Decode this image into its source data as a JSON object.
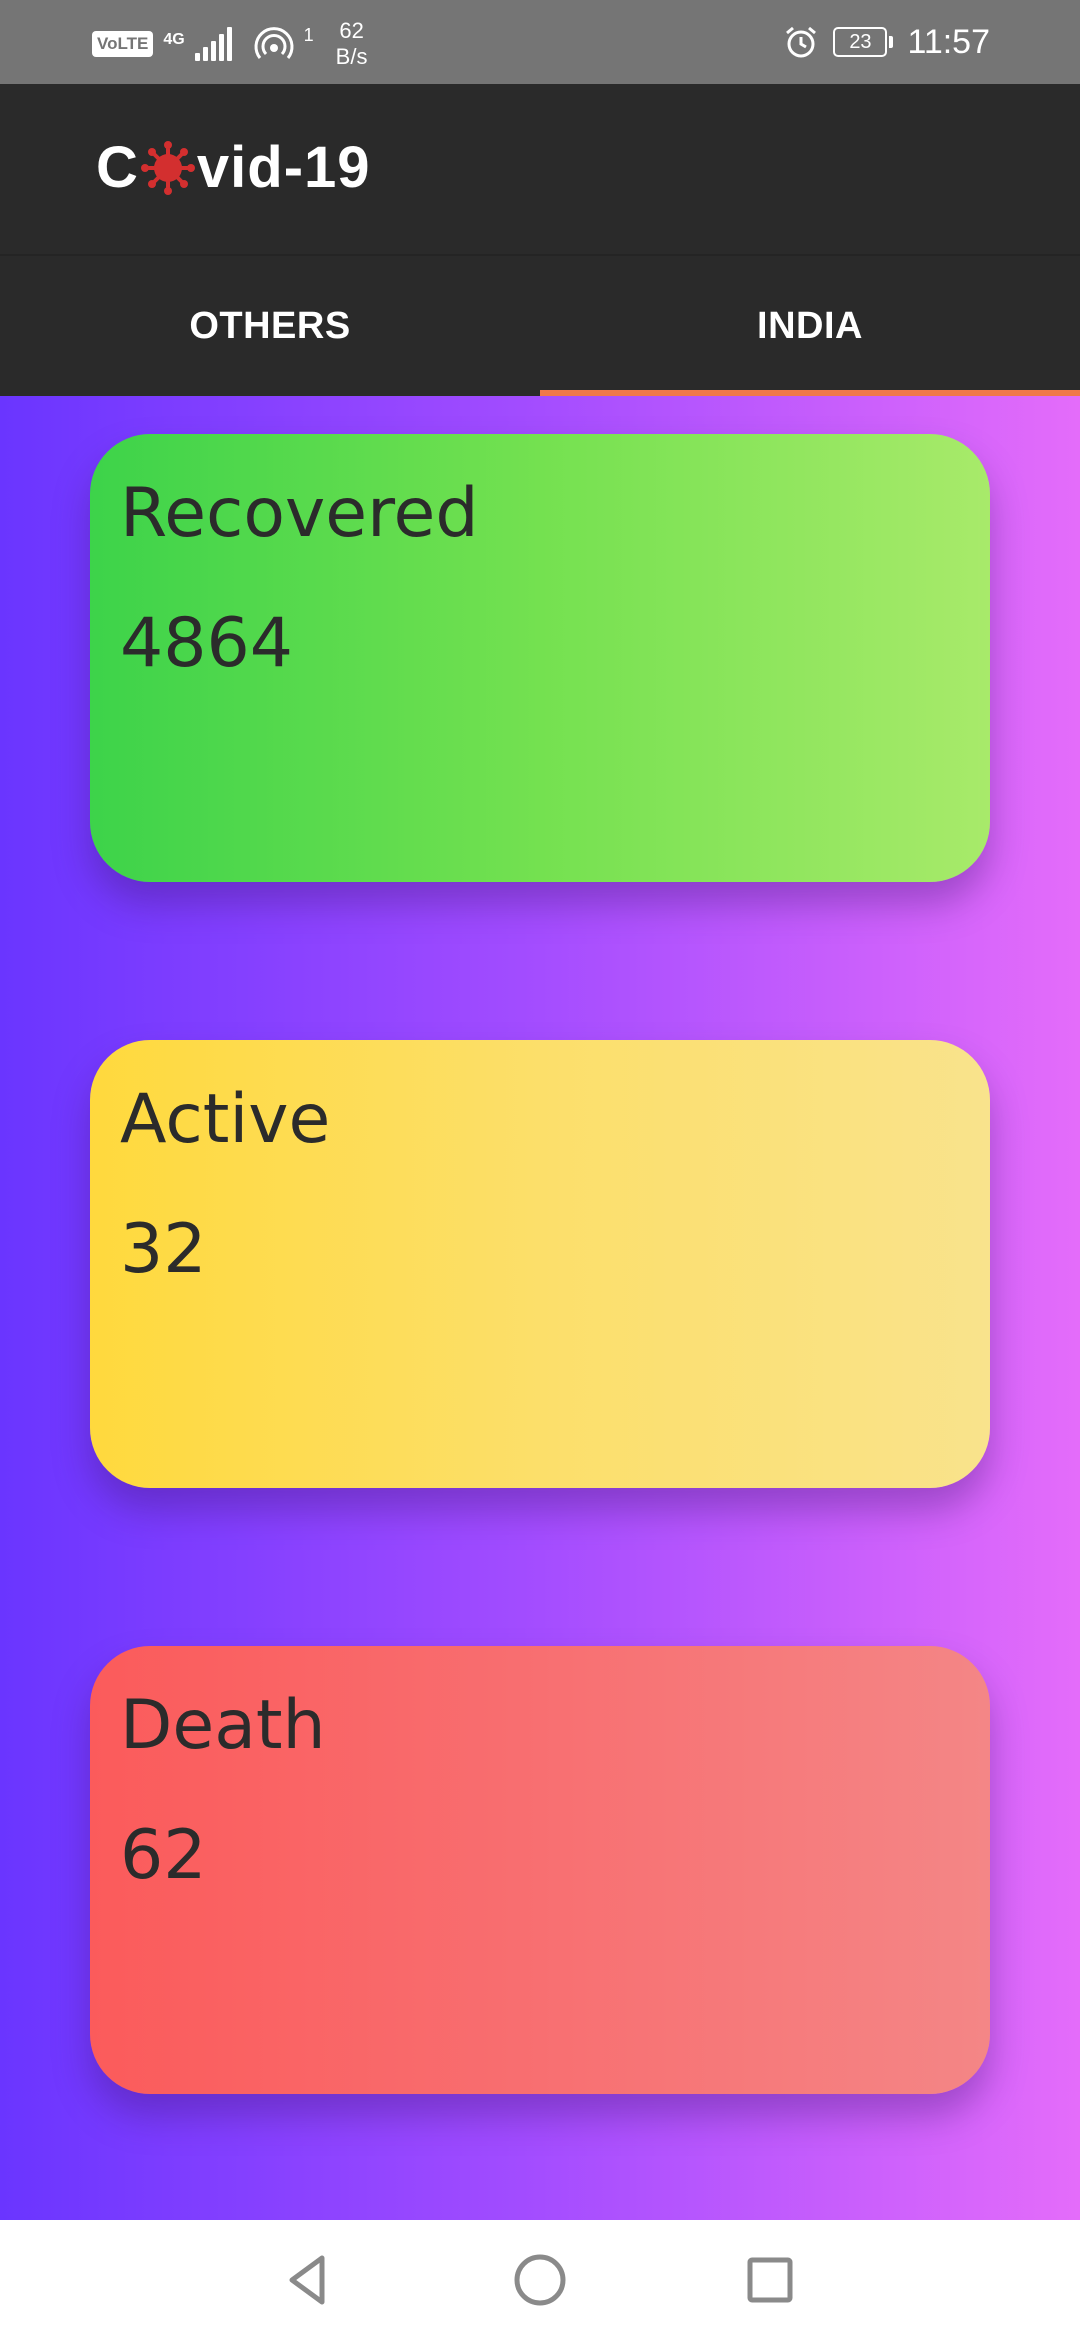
{
  "status_bar": {
    "volte_label": "VoLTE",
    "network_type": "4G",
    "hotspot_count": "1",
    "speed_value": "62",
    "speed_unit": "B/s",
    "battery_level": "23",
    "time": "11:57"
  },
  "app_bar": {
    "title_prefix": "C",
    "title_suffix": "vid-19",
    "logo_icon": "virus-icon",
    "logo_color": "#d32f2f"
  },
  "tabs": [
    {
      "label": "OTHERS",
      "selected": false
    },
    {
      "label": "INDIA",
      "selected": true
    }
  ],
  "tab_indicator_color": "#f0784a",
  "cards": [
    {
      "label": "Recovered",
      "value": "4864",
      "colors": [
        "#3dd34a",
        "#a8ea6a"
      ]
    },
    {
      "label": "Active",
      "value": "32",
      "colors": [
        "#ffd93d",
        "#f9e38c"
      ]
    },
    {
      "label": "Death",
      "value": "62",
      "colors": [
        "#fb5b5b",
        "#f48686"
      ]
    }
  ],
  "background_gradient": [
    "#6a35ff",
    "#e46cfa"
  ],
  "nav_bar": {
    "back_icon": "back-triangle-icon",
    "home_icon": "home-circle-icon",
    "recents_icon": "recents-square-icon"
  }
}
